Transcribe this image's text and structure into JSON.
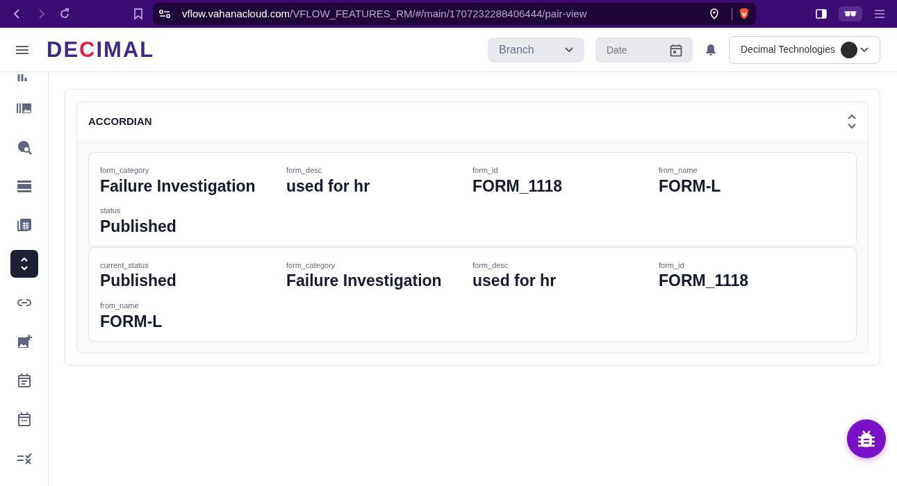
{
  "browser": {
    "host": "vflow.vahanacloud.com",
    "path": "/VFLOW_FEATURES_RM/#/main/1707232288406444/pair-view"
  },
  "header": {
    "logo": [
      {
        "text": "DE",
        "color": "#3f2a8c"
      },
      {
        "text": "C",
        "color": "#ea1d45"
      },
      {
        "text": "IMAL",
        "color": "#3f2a8c"
      }
    ],
    "branch_placeholder": "Branch",
    "date_placeholder": "Date",
    "account": "Decimal Technologies"
  },
  "sidebar": {
    "items": [
      {
        "selected": false
      },
      {
        "selected": false
      },
      {
        "selected": false
      },
      {
        "selected": false
      },
      {
        "selected": false
      },
      {
        "selected": true
      },
      {
        "selected": false
      },
      {
        "selected": false
      },
      {
        "selected": false
      },
      {
        "selected": false
      },
      {
        "selected": false
      }
    ]
  },
  "accordion": {
    "title": "ACCORDIAN",
    "expanded": true,
    "records": [
      {
        "fields": [
          {
            "label": "form_category",
            "value": "Failure Investigation"
          },
          {
            "label": "form_desc",
            "value": "used for hr"
          },
          {
            "label": "form_id",
            "value": "FORM_1118"
          },
          {
            "label": "from_name",
            "value": "FORM-L"
          },
          {
            "label": "status",
            "value": "Published"
          }
        ]
      },
      {
        "fields": [
          {
            "label": "current_status",
            "value": "Published"
          },
          {
            "label": "form_category",
            "value": "Failure Investigation"
          },
          {
            "label": "form_desc",
            "value": "used for hr"
          },
          {
            "label": "form_id",
            "value": "FORM_1118"
          },
          {
            "label": "from_name",
            "value": "FORM-L"
          }
        ]
      }
    ]
  }
}
